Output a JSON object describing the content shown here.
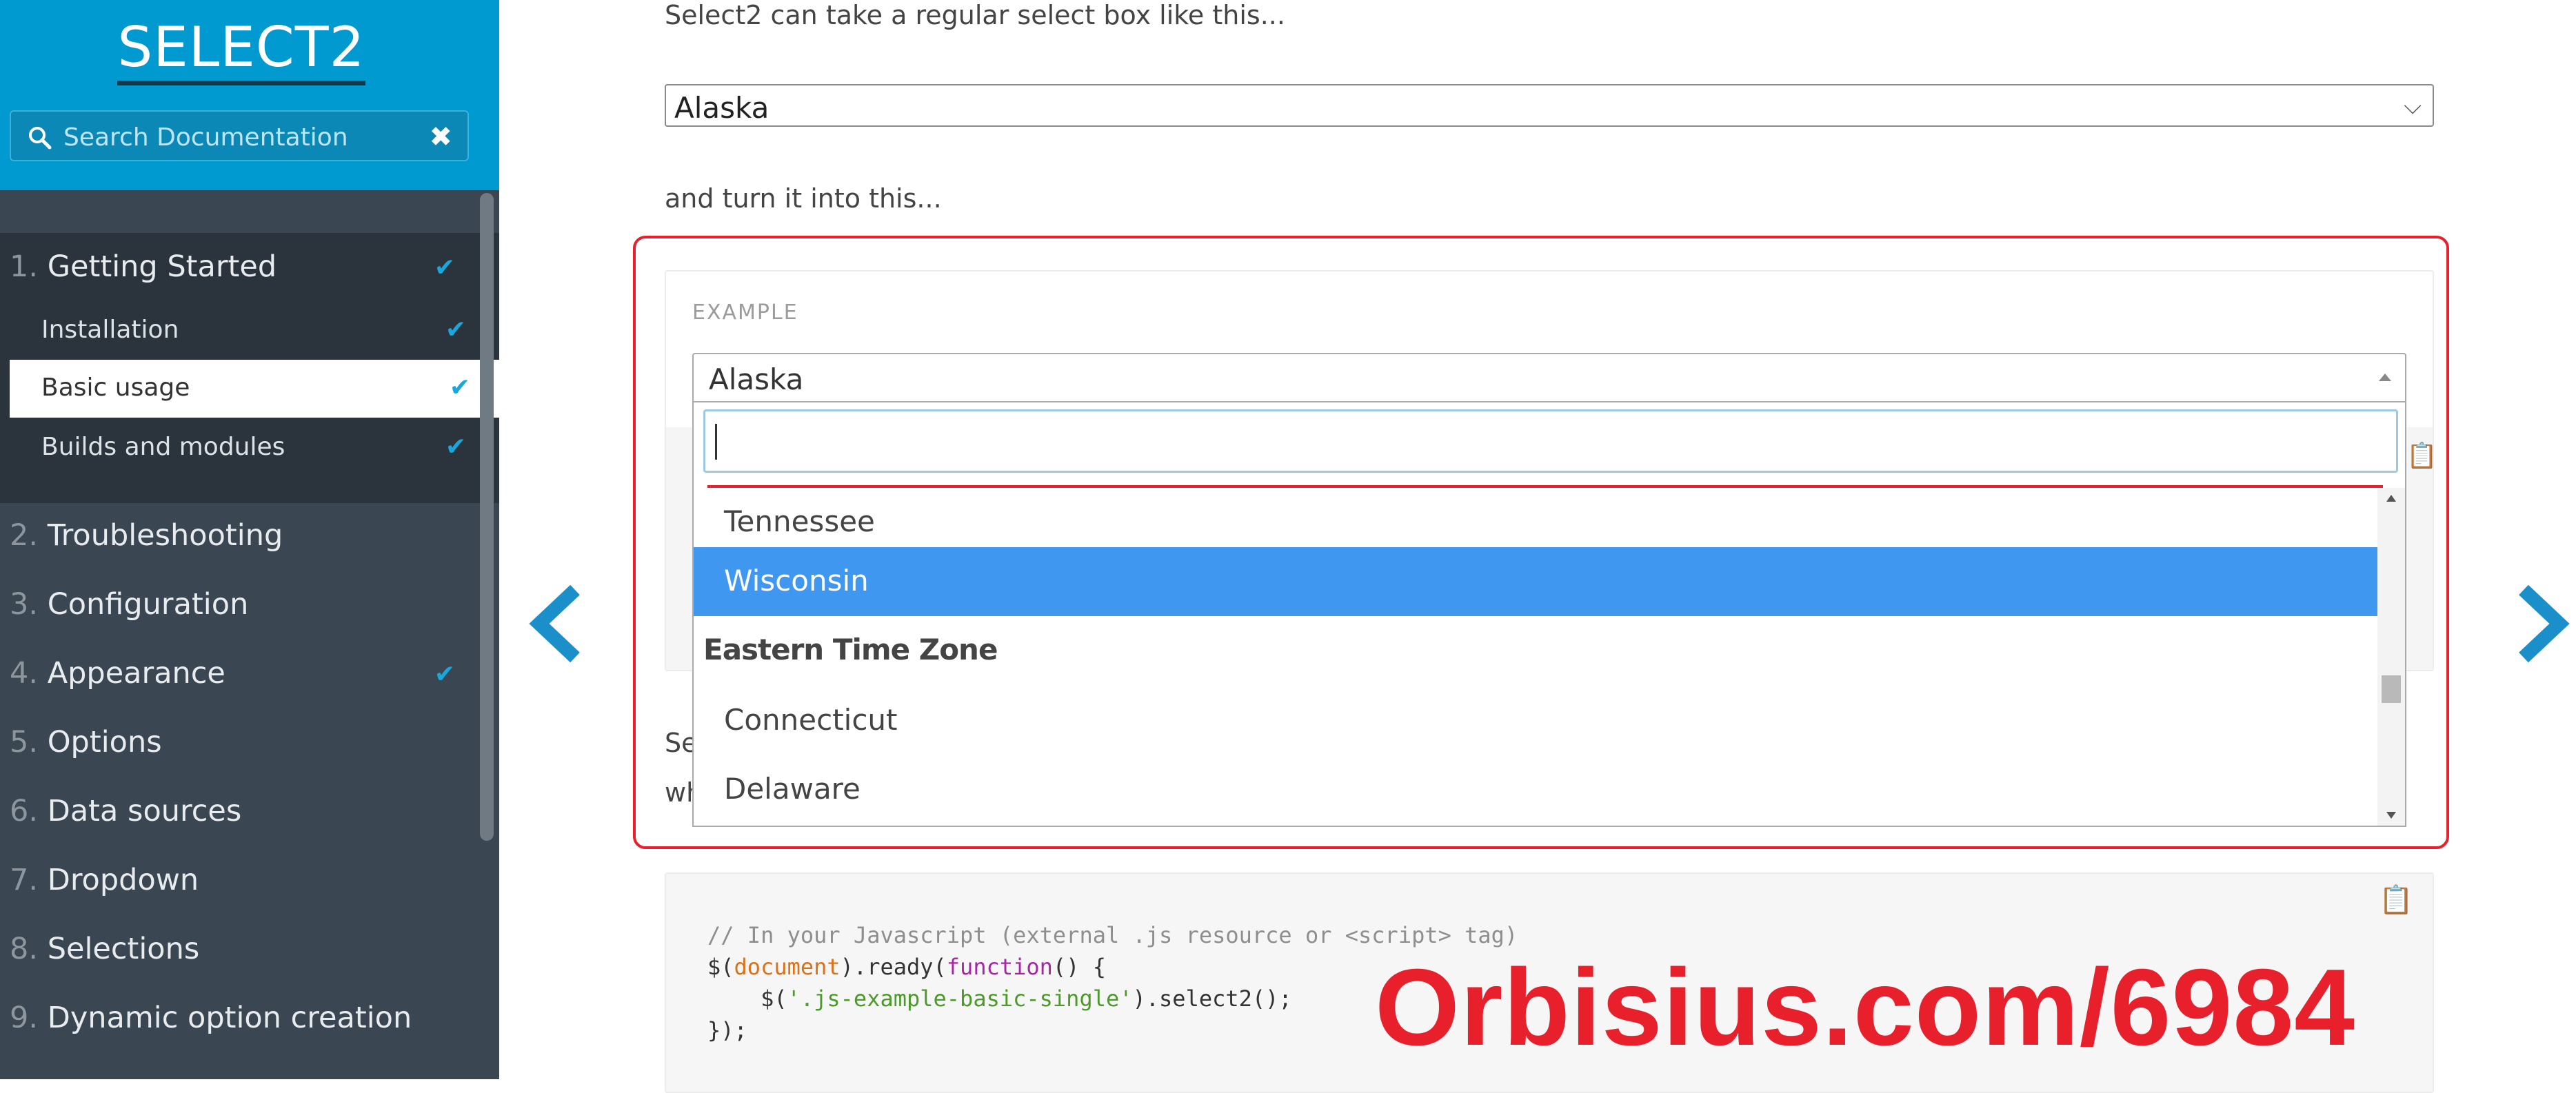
{
  "sidebar": {
    "brand": "SELECT2",
    "search_placeholder": "Search Documentation",
    "items": [
      {
        "num": "1.",
        "label": "Getting Started",
        "checked": true
      },
      {
        "num": "2.",
        "label": "Troubleshooting",
        "checked": false
      },
      {
        "num": "3.",
        "label": "Configuration",
        "checked": false
      },
      {
        "num": "4.",
        "label": "Appearance",
        "checked": true
      },
      {
        "num": "5.",
        "label": "Options",
        "checked": false
      },
      {
        "num": "6.",
        "label": "Data sources",
        "checked": false
      },
      {
        "num": "7.",
        "label": "Dropdown",
        "checked": false
      },
      {
        "num": "8.",
        "label": "Selections",
        "checked": false
      },
      {
        "num": "9.",
        "label": "Dynamic option creation",
        "checked": false
      }
    ],
    "sub_items": [
      {
        "label": "Installation",
        "checked": true
      },
      {
        "label": "Basic usage",
        "checked": true,
        "active": true
      },
      {
        "label": "Builds and modules",
        "checked": true
      }
    ]
  },
  "main": {
    "intro_text": "Select2 can take a regular select box like this...",
    "native_select_value": "Alaska",
    "turn_text": "and turn it into this...",
    "example_label": "EXAMPLE",
    "select2_value": "Alaska",
    "dropdown_options": [
      {
        "label": "Tennessee",
        "type": "option"
      },
      {
        "label": "Wisconsin",
        "type": "option",
        "highlighted": true
      },
      {
        "label": "Eastern Time Zone",
        "type": "group"
      },
      {
        "label": "Connecticut",
        "type": "option"
      },
      {
        "label": "Delaware",
        "type": "option"
      }
    ],
    "partial_text_1": "Se",
    "partial_text_2": "wh",
    "code_lines": {
      "comment": "// In your Javascript (external .js resource or <script> tag)",
      "l2_a": "$(",
      "l2_doc": "document",
      "l2_b": ").ready(",
      "l2_fn": "function",
      "l2_c": "() {",
      "l3_a": "    $(",
      "l3_str": "'.js-example-basic-single'",
      "l3_b": ").select2();",
      "l4": "});"
    }
  },
  "watermark": "Orbisius.com/6984",
  "colors": {
    "brand_blue": "#0099d0",
    "sidebar_bg": "#3a4651",
    "highlight": "#3f97f0",
    "annotation_red": "#e8202c",
    "check": "#1aa8dc"
  }
}
